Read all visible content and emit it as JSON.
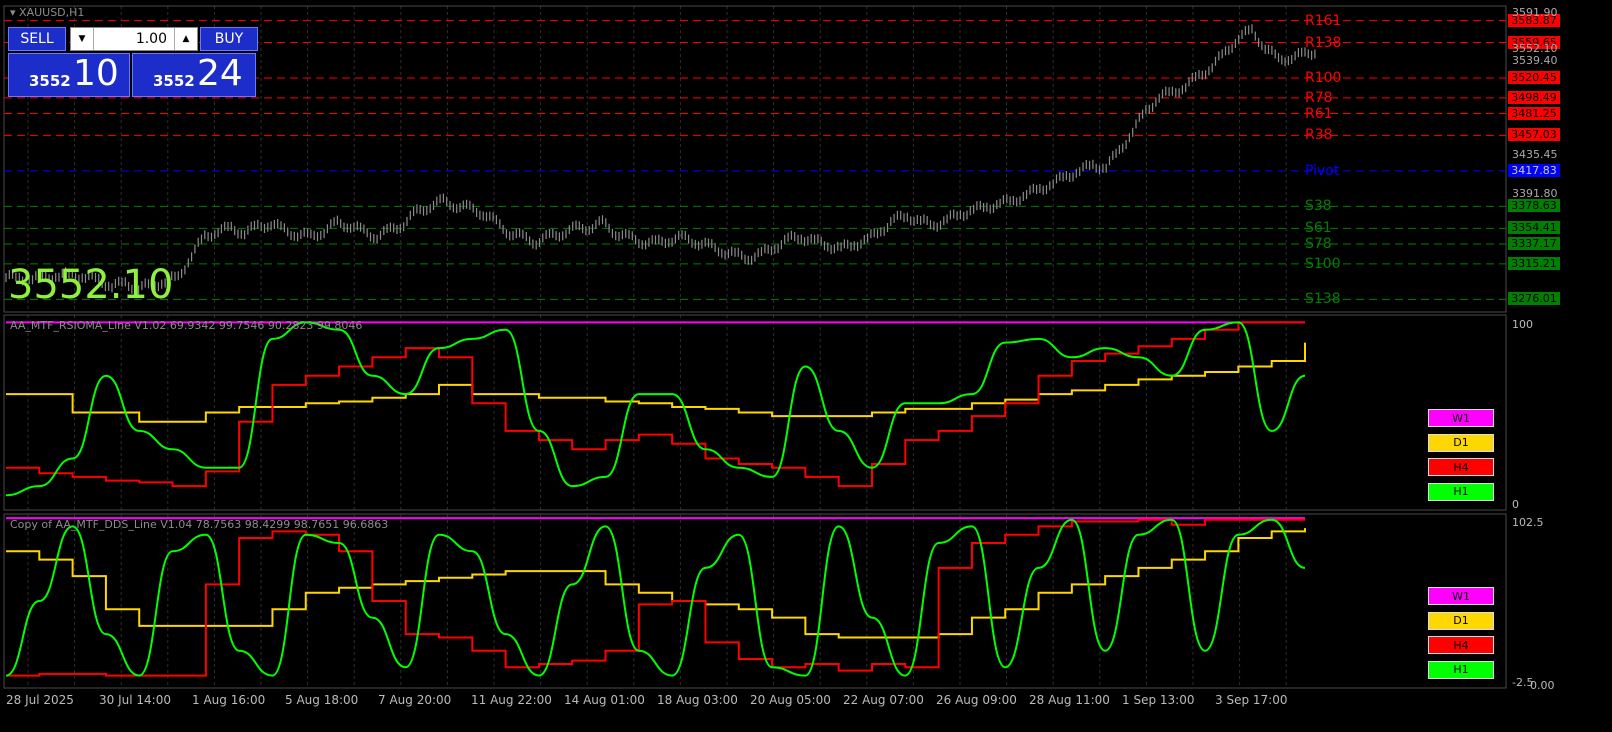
{
  "chart_data": {
    "type": "line",
    "title": "XAUUSD,H1",
    "price": {
      "close_series": [
        3300,
        3298,
        3302,
        3301,
        3304,
        3300,
        3298,
        3290,
        3294,
        3288,
        3292,
        3296,
        3300,
        3325,
        3345,
        3352,
        3354,
        3350,
        3356,
        3360,
        3352,
        3348,
        3345,
        3352,
        3360,
        3358,
        3350,
        3346,
        3352,
        3360,
        3372,
        3380,
        3384,
        3380,
        3376,
        3372,
        3360,
        3350,
        3344,
        3340,
        3345,
        3350,
        3354,
        3356,
        3360,
        3350,
        3344,
        3340,
        3338,
        3342,
        3344,
        3340,
        3335,
        3330,
        3325,
        3322,
        3326,
        3334,
        3342,
        3345,
        3340,
        3336,
        3332,
        3337,
        3342,
        3352,
        3364,
        3368,
        3362,
        3358,
        3364,
        3370,
        3375,
        3378,
        3382,
        3385,
        3392,
        3398,
        3404,
        3412,
        3418,
        3424,
        3422,
        3440,
        3462,
        3484,
        3500,
        3504,
        3512,
        3522,
        3534,
        3548,
        3566,
        3572,
        3555,
        3540,
        3544,
        3546,
        3552
      ],
      "current": "3552.10",
      "ticks": [
        "3591.90",
        "3552.10",
        "3539.40",
        "3435.45",
        "3391.80"
      ]
    },
    "levels": [
      {
        "name": "R161",
        "value": "3583.87",
        "color": "#ff0000"
      },
      {
        "name": "R138",
        "value": "3559.65",
        "color": "#ff0000"
      },
      {
        "name": "R100",
        "value": "3520.45",
        "color": "#ff0000"
      },
      {
        "name": "R78",
        "value": "3498.49",
        "color": "#ff0000"
      },
      {
        "name": "R61",
        "value": "3481.25",
        "color": "#ff0000"
      },
      {
        "name": "R38",
        "value": "3457.03",
        "color": "#ff0000"
      },
      {
        "name": "Pivot",
        "value": "3417.83",
        "color": "#0000ff"
      },
      {
        "name": "S38",
        "value": "3378.63",
        "color": "#008000"
      },
      {
        "name": "S61",
        "value": "3354.41",
        "color": "#008000"
      },
      {
        "name": "S78",
        "value": "3337.17",
        "color": "#008000"
      },
      {
        "name": "S100",
        "value": "3315.21",
        "color": "#008000"
      },
      {
        "name": "S138",
        "value": "3276.01",
        "color": "#008000"
      }
    ],
    "indicator1": {
      "title": "AA_MTF_RSIOMA_Line V1.02 69.9342 99.7546 90.2823 99.8046",
      "scale_top": "100",
      "scale_bottom": "0",
      "series": [
        {
          "name": "W1",
          "color": "#ff00ff",
          "values": [
            99,
            99,
            99,
            99,
            99,
            99,
            99,
            99,
            99,
            99,
            99,
            99,
            99,
            99,
            99,
            99,
            99,
            99,
            99,
            99,
            99,
            99,
            99,
            99,
            99,
            99,
            99,
            99,
            99,
            99,
            99,
            99,
            99,
            99,
            99,
            99,
            99,
            99,
            99,
            99
          ]
        },
        {
          "name": "D1",
          "color": "#ffd700",
          "values": [
            60,
            60,
            50,
            50,
            45,
            45,
            50,
            53,
            53,
            55,
            56,
            58,
            60,
            65,
            60,
            60,
            58,
            58,
            56,
            55,
            53,
            52,
            50,
            48,
            48,
            48,
            50,
            52,
            52,
            55,
            57,
            60,
            62,
            65,
            68,
            70,
            72,
            75,
            78,
            88
          ]
        },
        {
          "name": "H4",
          "color": "#ff0000",
          "values": [
            20,
            17,
            15,
            13,
            12,
            10,
            18,
            45,
            65,
            70,
            75,
            80,
            85,
            80,
            55,
            40,
            35,
            30,
            35,
            38,
            33,
            25,
            22,
            20,
            15,
            10,
            22,
            35,
            40,
            48,
            55,
            70,
            78,
            82,
            86,
            90,
            95,
            99,
            99,
            99
          ]
        },
        {
          "name": "H1",
          "color": "#00ff00",
          "values": [
            5,
            10,
            25,
            70,
            40,
            30,
            20,
            20,
            90,
            99,
            95,
            70,
            60,
            85,
            90,
            95,
            40,
            10,
            15,
            60,
            60,
            30,
            20,
            15,
            75,
            40,
            20,
            55,
            55,
            60,
            88,
            90,
            80,
            85,
            80,
            70,
            95,
            99,
            40,
            70
          ]
        }
      ]
    },
    "indicator2": {
      "title": "Copy of AA_MTF_DDS_Line V1.04 78.7563 98.4299 98.7651 96.6863",
      "scale_top": "102.5",
      "scale_bottom": "-2.5",
      "bottom_extra": "0.00",
      "series": [
        {
          "name": "W1",
          "color": "#ff00ff",
          "values": [
            100,
            100,
            100,
            100,
            100,
            100,
            100,
            100,
            100,
            100,
            100,
            100,
            100,
            100,
            100,
            100,
            100,
            100,
            100,
            100,
            100,
            100,
            100,
            100,
            100,
            100,
            100,
            100,
            100,
            100,
            100,
            100,
            100,
            100,
            100,
            100,
            100,
            100,
            100,
            100
          ]
        },
        {
          "name": "D1",
          "color": "#ffd700",
          "values": [
            80,
            75,
            65,
            45,
            35,
            35,
            35,
            35,
            45,
            55,
            58,
            60,
            62,
            64,
            66,
            68,
            68,
            68,
            60,
            55,
            50,
            48,
            45,
            40,
            30,
            28,
            28,
            28,
            30,
            40,
            45,
            55,
            60,
            65,
            70,
            75,
            80,
            88,
            92,
            94
          ]
        },
        {
          "name": "H4",
          "color": "#ff0000",
          "values": [
            5,
            6,
            6,
            5,
            5,
            5,
            60,
            88,
            92,
            90,
            80,
            50,
            30,
            28,
            20,
            10,
            12,
            14,
            20,
            48,
            50,
            25,
            15,
            10,
            12,
            8,
            12,
            10,
            70,
            85,
            90,
            95,
            98,
            98,
            99,
            96,
            99,
            99,
            99,
            99
          ]
        },
        {
          "name": "H1",
          "color": "#00ff00",
          "values": [
            5,
            50,
            95,
            30,
            5,
            80,
            90,
            20,
            5,
            90,
            85,
            40,
            10,
            90,
            80,
            30,
            5,
            60,
            95,
            20,
            5,
            70,
            90,
            10,
            5,
            95,
            40,
            5,
            85,
            95,
            10,
            70,
            99,
            20,
            90,
            99,
            20,
            90,
            99,
            70
          ]
        }
      ]
    },
    "time_labels": [
      "28 Jul 2025",
      "30 Jul 14:00",
      "1 Aug 16:00",
      "5 Aug 18:00",
      "7 Aug 20:00",
      "11 Aug 22:00",
      "14 Aug 01:00",
      "18 Aug 03:00",
      "20 Aug 05:00",
      "22 Aug 07:00",
      "26 Aug 09:00",
      "28 Aug 11:00",
      "1 Sep 13:00",
      "3 Sep 17:00"
    ]
  },
  "one_click": {
    "sell_label": "SELL",
    "buy_label": "BUY",
    "volume": "1.00",
    "bid_small": "3552",
    "bid_big": "10",
    "ask_small": "3552",
    "ask_big": "24"
  },
  "colors": {
    "grid": "#2e2e2e",
    "price_line": "#8c8c8c",
    "big_price": "#8ef23d",
    "panel_border": "#4a4a4a"
  }
}
